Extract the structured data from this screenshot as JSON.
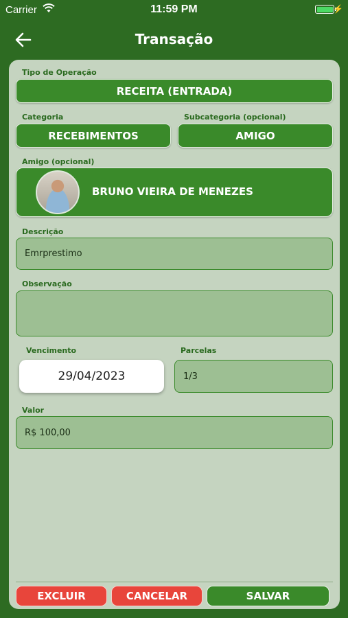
{
  "status_bar": {
    "carrier": "Carrier",
    "time": "11:59 PM"
  },
  "nav": {
    "title": "Transação",
    "back_icon": "arrow-left-icon"
  },
  "form": {
    "tipo_label": "Tipo de Operação",
    "tipo_value": "RECEITA (ENTRADA)",
    "categoria_label": "Categoria",
    "categoria_value": "RECEBIMENTOS",
    "subcategoria_label": "Subcategoria (opcional)",
    "subcategoria_value": "AMIGO",
    "amigo_label": "Amigo (opcional)",
    "amigo_name": "BRUNO VIEIRA DE MENEZES",
    "descricao_label": "Descrição",
    "descricao_value": "Emrprestimo",
    "observacao_label": "Observação",
    "observacao_value": "",
    "vencimento_label": "Vencimento",
    "vencimento_value": "29/04/2023",
    "parcelas_label": "Parcelas",
    "parcelas_value": "1/3",
    "valor_label": "Valor",
    "valor_value": "R$ 100,00"
  },
  "actions": {
    "excluir": "EXCLUIR",
    "cancelar": "CANCELAR",
    "salvar": "SALVAR"
  },
  "colors": {
    "background": "#2d6b22",
    "card": "#c5d4c0",
    "primary_green": "#3a8a2a",
    "danger_red": "#e8453b"
  }
}
